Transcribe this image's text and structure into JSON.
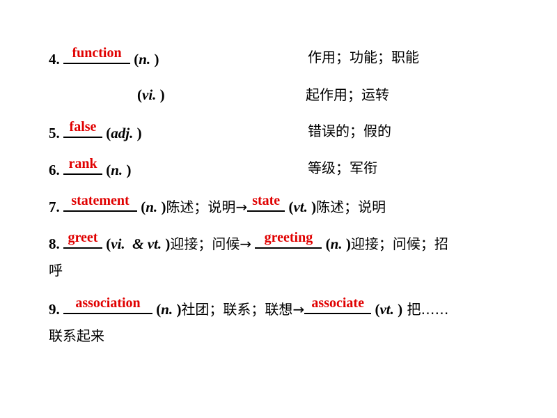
{
  "items": [
    {
      "num": "4.",
      "answer": "function",
      "pos": "(n. )",
      "pos_label": "n.",
      "meaning": "作用；功能；职能",
      "pos2_label": "vi.",
      "meaning2": "起作用；运转"
    },
    {
      "num": "5.",
      "answer": "false",
      "pos_label": "adj.",
      "meaning": "错误的；假的"
    },
    {
      "num": "6.",
      "answer": "rank",
      "pos_label": "n.",
      "meaning": "等级；军衔"
    },
    {
      "num": "7.",
      "answer": "statement",
      "pos_label": "n.",
      "meaning": "陈述；说明",
      "arrow": "→",
      "answer2": "state",
      "pos2_label": "vt.",
      "meaning2": "陈述；说明"
    },
    {
      "num": "8.",
      "answer": "greet",
      "pos_label": "vi.  & vt.",
      "meaning": "迎接；问候",
      "arrow": "→",
      "answer2": "greeting",
      "pos2_label": "n.",
      "meaning2": "迎接；问候；招",
      "meaning2_cont": "呼"
    },
    {
      "num": "9.",
      "answer": "association",
      "pos_label": "n.",
      "meaning": "社团；联系；联想",
      "arrow": "→",
      "answer2": "associate",
      "pos2_label": "vt.",
      "meaning2": " 把……",
      "meaning2_cont": "联系起来"
    }
  ],
  "colors": {
    "answer": "#e00000",
    "text": "#000000",
    "background": "#ffffff"
  }
}
